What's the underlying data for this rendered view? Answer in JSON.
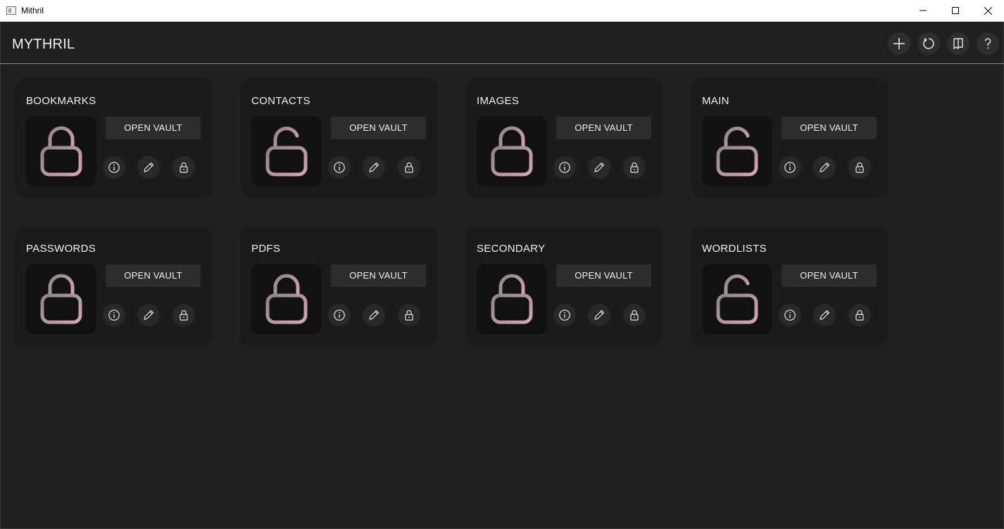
{
  "window": {
    "title": "Mithril"
  },
  "header": {
    "title": "MYTHRIL",
    "buttons": [
      {
        "icon": "plus-icon"
      },
      {
        "icon": "refresh-icon"
      },
      {
        "icon": "bookmark-icon"
      },
      {
        "icon": "help-icon"
      }
    ]
  },
  "colors": {
    "background": "#202020",
    "card": "#1b1b1b",
    "lock_gradient_start": "#8e8489",
    "lock_gradient_end": "#d6a6ad"
  },
  "vaults": [
    {
      "name": "BOOKMARKS",
      "open_label": "OPEN VAULT",
      "locked": true
    },
    {
      "name": "CONTACTS",
      "open_label": "OPEN VAULT",
      "locked": false
    },
    {
      "name": "IMAGES",
      "open_label": "OPEN VAULT",
      "locked": true
    },
    {
      "name": "MAIN",
      "open_label": "OPEN VAULT",
      "locked": false
    },
    {
      "name": "PASSWORDS",
      "open_label": "OPEN VAULT",
      "locked": true
    },
    {
      "name": "PDFS",
      "open_label": "OPEN VAULT",
      "locked": true
    },
    {
      "name": "SECONDARY",
      "open_label": "OPEN VAULT",
      "locked": true
    },
    {
      "name": "WORDLISTS",
      "open_label": "OPEN VAULT",
      "locked": false
    }
  ]
}
